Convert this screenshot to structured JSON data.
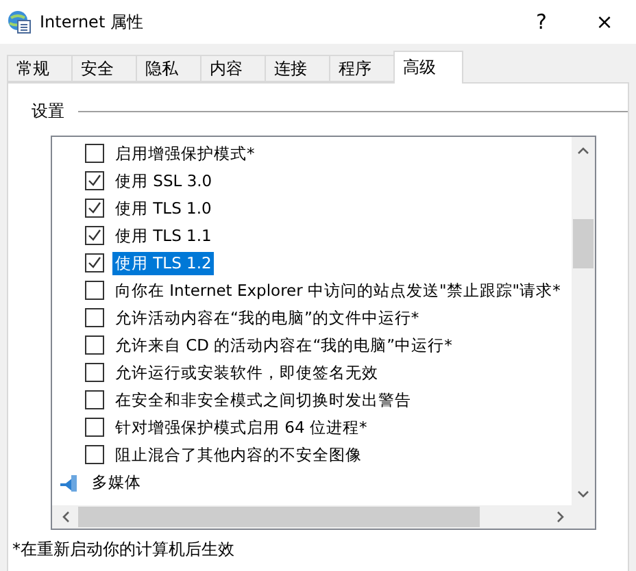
{
  "window": {
    "title": "Internet 属性",
    "help": "?",
    "close": "×"
  },
  "tabs": [
    {
      "label": "常规",
      "selected": false
    },
    {
      "label": "安全",
      "selected": false
    },
    {
      "label": "隐私",
      "selected": false
    },
    {
      "label": "内容",
      "selected": false
    },
    {
      "label": "连接",
      "selected": false
    },
    {
      "label": "程序",
      "selected": false
    },
    {
      "label": "高级",
      "selected": true
    }
  ],
  "settings": {
    "label": "设置",
    "items": [
      {
        "kind": "checkbox",
        "label": "启用增强保护模式*",
        "checked": false,
        "selected": false
      },
      {
        "kind": "checkbox",
        "label": "使用 SSL 3.0",
        "checked": true,
        "selected": false
      },
      {
        "kind": "checkbox",
        "label": "使用 TLS 1.0",
        "checked": true,
        "selected": false
      },
      {
        "kind": "checkbox",
        "label": "使用 TLS 1.1",
        "checked": true,
        "selected": false
      },
      {
        "kind": "checkbox",
        "label": "使用 TLS 1.2",
        "checked": true,
        "selected": true
      },
      {
        "kind": "checkbox",
        "label": "向你在 Internet Explorer 中访问的站点发送\"禁止跟踪\"请求*",
        "checked": false,
        "selected": false
      },
      {
        "kind": "checkbox",
        "label": "允许活动内容在“我的电脑”的文件中运行*",
        "checked": false,
        "selected": false
      },
      {
        "kind": "checkbox",
        "label": "允许来自 CD 的活动内容在“我的电脑”中运行*",
        "checked": false,
        "selected": false
      },
      {
        "kind": "checkbox",
        "label": "允许运行或安装软件，即使签名无效",
        "checked": false,
        "selected": false
      },
      {
        "kind": "checkbox",
        "label": "在安全和非安全模式之间切换时发出警告",
        "checked": false,
        "selected": false
      },
      {
        "kind": "checkbox",
        "label": "针对增强保护模式启用 64 位进程*",
        "checked": false,
        "selected": false
      },
      {
        "kind": "checkbox",
        "label": "阻止混合了其他内容的不安全图像",
        "checked": false,
        "selected": false
      },
      {
        "kind": "category",
        "label": "多媒体"
      }
    ]
  },
  "note": "*在重新启动你的计算机后生效"
}
